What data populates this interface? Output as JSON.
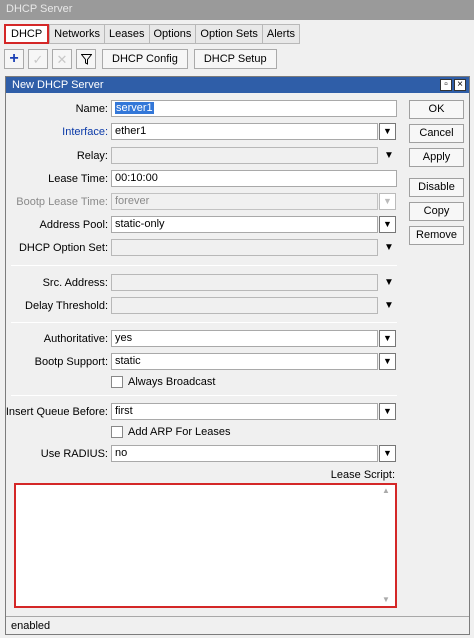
{
  "window": {
    "title": "DHCP Server"
  },
  "tabs": [
    {
      "label": "DHCP",
      "active": true
    },
    {
      "label": "Networks"
    },
    {
      "label": "Leases"
    },
    {
      "label": "Options"
    },
    {
      "label": "Option Sets"
    },
    {
      "label": "Alerts"
    }
  ],
  "toolbar": {
    "add_icon": "plus-icon",
    "enable_icon": "checkmark-icon",
    "disable_icon": "cross-icon",
    "filter_icon": "filter-icon",
    "dhcp_config_label": "DHCP Config",
    "dhcp_setup_label": "DHCP Setup"
  },
  "dialog": {
    "title": "New DHCP Server",
    "fields": {
      "name": {
        "label": "Name:",
        "value": "server1"
      },
      "interface": {
        "label": "Interface:",
        "value": "ether1"
      },
      "relay": {
        "label": "Relay:",
        "value": ""
      },
      "lease_time": {
        "label": "Lease Time:",
        "value": "00:10:00"
      },
      "bootp_lease_time": {
        "label": "Bootp Lease Time:",
        "value": "forever"
      },
      "address_pool": {
        "label": "Address Pool:",
        "value": "static-only"
      },
      "dhcp_option_set": {
        "label": "DHCP Option Set:",
        "value": ""
      },
      "src_address": {
        "label": "Src. Address:",
        "value": ""
      },
      "delay_threshold": {
        "label": "Delay Threshold:",
        "value": ""
      },
      "authoritative": {
        "label": "Authoritative:",
        "value": "yes"
      },
      "bootp_support": {
        "label": "Bootp Support:",
        "value": "static"
      },
      "insert_queue_before": {
        "label": "Insert Queue Before:",
        "value": "first"
      },
      "use_radius": {
        "label": "Use RADIUS:",
        "value": "no"
      }
    },
    "checkboxes": {
      "always_broadcast": {
        "label": "Always Broadcast",
        "checked": false
      },
      "add_arp": {
        "label": "Add ARP For Leases",
        "checked": false
      }
    },
    "lease_script": {
      "label": "Lease Script:",
      "value": ""
    },
    "buttons": {
      "ok": "OK",
      "cancel": "Cancel",
      "apply": "Apply",
      "disable": "Disable",
      "copy": "Copy",
      "remove": "Remove"
    },
    "status": "enabled"
  },
  "colors": {
    "title_bar": "#2f5ea8",
    "highlight": "#d42727",
    "link_label": "#0b3aa8"
  }
}
